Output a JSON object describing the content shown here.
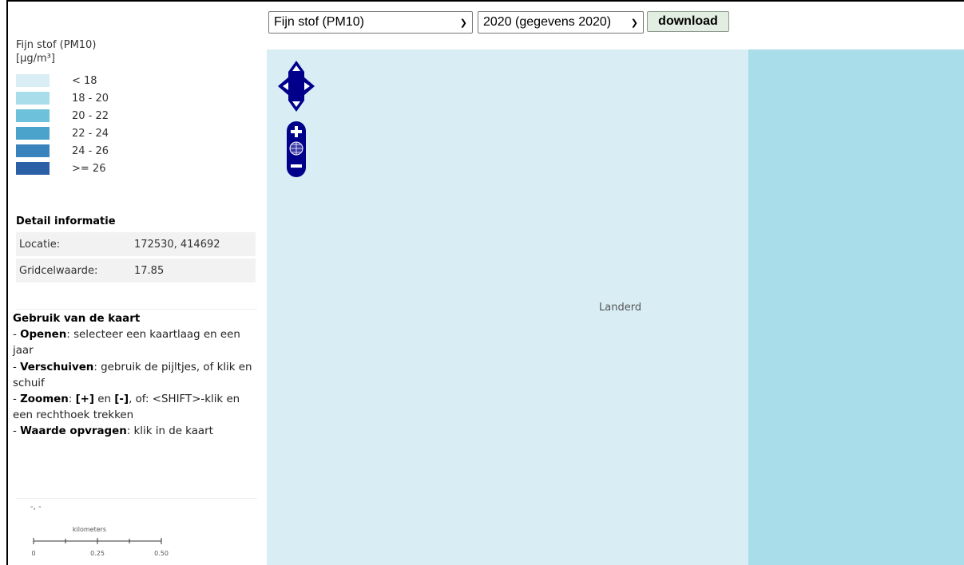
{
  "controls": {
    "layer_select": "Fijn stof (PM10)",
    "year_select": "2020 (gegevens 2020)",
    "download_label": "download"
  },
  "legend": {
    "title": "Fijn stof (PM10)",
    "unit": "[µg/m³]",
    "classes": [
      {
        "label": "< 18",
        "color": "#d8eef4"
      },
      {
        "label": "18 - 20",
        "color": "#a8dde9"
      },
      {
        "label": "20 - 22",
        "color": "#6ec1da"
      },
      {
        "label": "22 - 24",
        "color": "#4ba3cc"
      },
      {
        "label": "24 - 26",
        "color": "#3882bd"
      },
      {
        "label": ">= 26",
        "color": "#2b5fa6"
      }
    ]
  },
  "detail": {
    "heading": "Detail informatie",
    "rows": [
      {
        "key": "Locatie:",
        "value": "172530, 414692"
      },
      {
        "key": "Gridcelwaarde:",
        "value": "17.85"
      }
    ]
  },
  "usage": {
    "heading": "Gebruik van de kaart",
    "items": [
      {
        "bold": "Openen",
        "text": ": selecteer een kaartlaag en een jaar"
      },
      {
        "bold": "Verschuiven",
        "text": ": gebruik de pijltjes, of klik en schuif"
      },
      {
        "bold": "Zoomen",
        "bold2": "[+]",
        "mid": " en ",
        "bold3": "[-]",
        "text": ", of: <SHIFT>-klik en een rechthoek trekken"
      },
      {
        "bold": "Waarde opvragen",
        "text": ": klik in de kaart"
      }
    ]
  },
  "coords_readout": "-, -",
  "scalebar": {
    "unit": "kilometers",
    "ticks": [
      "0",
      "0.25",
      "0.50"
    ]
  },
  "map": {
    "place_label": "Landerd",
    "colors": {
      "left": "#d8eef4",
      "right": "#a8dde9",
      "controls": "#00008b"
    }
  }
}
